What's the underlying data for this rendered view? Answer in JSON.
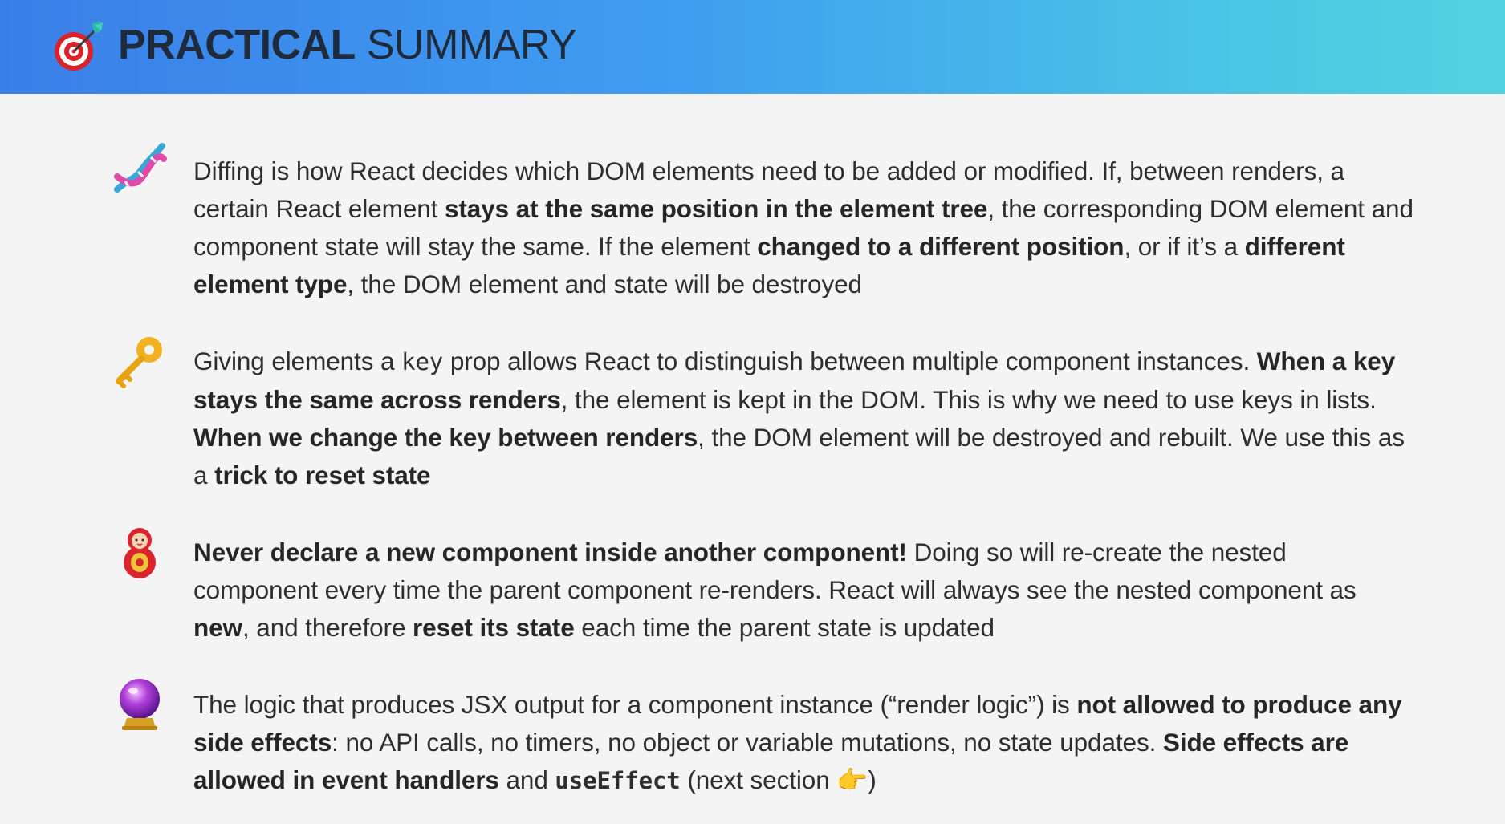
{
  "header": {
    "icon": "target-with-dart-icon",
    "title_bold": "PRACTICAL",
    "title_rest": " SUMMARY",
    "gradient_colors": [
      "#3a7fe8",
      "#52d3e0"
    ]
  },
  "items": [
    {
      "icon": "dna-icon",
      "segments": [
        {
          "t": "Diffing is how React decides which DOM elements need to be added or modified. If, between renders, a certain React element "
        },
        {
          "t": "stays at the same position in the element tree"
        },
        {
          "t": ", the corresponding DOM element and component state will stay the same. If the element "
        },
        {
          "t": "changed to a different position"
        },
        {
          "t": ", or if it’s a "
        },
        {
          "t": "different element type"
        },
        {
          "t": ", the DOM element and state will be destroyed"
        }
      ]
    },
    {
      "icon": "key-icon",
      "segments": [
        {
          "t": "Giving elements a "
        },
        {
          "t": "key"
        },
        {
          "t": " prop allows React to distinguish between multiple component instances. "
        },
        {
          "t": "When a key stays the same across renders"
        },
        {
          "t": ", the element is kept in the DOM. This is why we need to use keys in lists. "
        },
        {
          "t": "When we change the key between renders"
        },
        {
          "t": ", the DOM element will be destroyed and rebuilt. We use this as a "
        },
        {
          "t": "trick to reset state"
        }
      ]
    },
    {
      "icon": "nesting-doll-icon",
      "segments": [
        {
          "t": "Never declare a new component inside another component!"
        },
        {
          "t": " Doing so will re-create the nested component every time the parent component re-renders. React will always see the nested component as "
        },
        {
          "t": "new"
        },
        {
          "t": ", and therefore "
        },
        {
          "t": "reset its state"
        },
        {
          "t": " each time the parent state is updated"
        }
      ]
    },
    {
      "icon": "crystal-ball-icon",
      "segments": [
        {
          "t": "The logic that produces JSX output for a component instance (“render logic”) is "
        },
        {
          "t": "not allowed to produce any side effects"
        },
        {
          "t": ": no API calls, no timers, no object or variable mutations, no state updates. "
        },
        {
          "t": "Side effects are allowed in event handlers"
        },
        {
          "t": " and "
        },
        {
          "t": "useEffect"
        },
        {
          "t": " (next section "
        },
        {
          "t": "👉"
        },
        {
          "t": ")"
        }
      ]
    }
  ]
}
